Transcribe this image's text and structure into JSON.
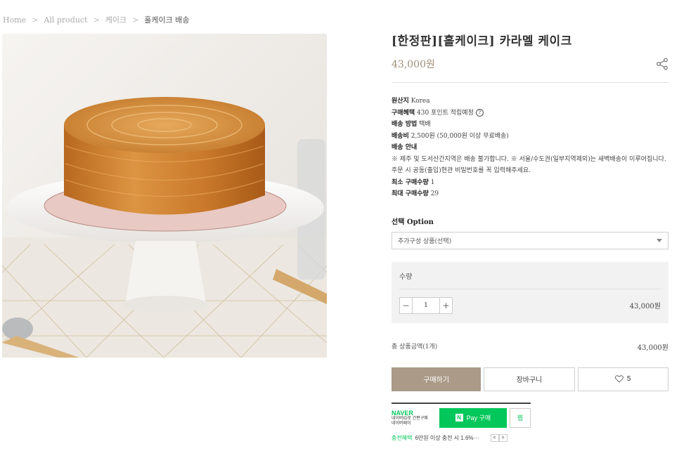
{
  "breadcrumb": {
    "items": [
      "Home",
      "All product",
      "케이크"
    ],
    "current": "홀케이크 배송",
    "separator": ">"
  },
  "product": {
    "title": "[한정판][홀케이크] 카라멜 케이크",
    "price": "43,000원",
    "share_icon": "share-icon"
  },
  "specs": {
    "origin_label": "원산지",
    "origin_value": "Korea",
    "benefit_label": "구매혜택",
    "benefit_value": "430 포인트 적립예정",
    "ship_method_label": "배송 방법",
    "ship_method_value": "택배",
    "ship_fee_label": "배송비",
    "ship_fee_value": "2,500원 (50,000원 이상 무료배송)",
    "ship_guide_label": "배송 안내",
    "ship_guide_text": "※ 제주 및 도서산간지역은 배송 불가합니다. ※ 서울/수도권(일부지역제외)는 새벽배송이 이루어집니다. 주문 시 공동(출입)현관 비밀번호를 꼭 입력해주세요.",
    "min_qty_label": "최소 구매수량",
    "min_qty_value": "1",
    "max_qty_label": "최대 구매수량",
    "max_qty_value": "29"
  },
  "option": {
    "label": "선택 Option",
    "selected": "추가구성 상품(선택)"
  },
  "quantity": {
    "label": "수량",
    "minus": "−",
    "value": "1",
    "plus": "+",
    "line_price": "43,000원"
  },
  "total": {
    "label": "총 상품금액(1개)",
    "price": "43,000원"
  },
  "actions": {
    "buy": "구매하기",
    "cart": "장바구니",
    "wish_count": "5"
  },
  "naver": {
    "logo": "NAVER",
    "sub1": "네이버ID로 간편구매",
    "sub2": "네이버페이",
    "pay_badge": "N",
    "pay_label": "Pay 구매",
    "zzim": "찜",
    "benefit_tag": "충전혜택",
    "benefit_text": "6만원 이상 충전 시 1.6%···",
    "prev": "<",
    "next": ">"
  },
  "colors": {
    "accent": "#aa9a87",
    "price": "#a08c76",
    "naver_green": "#03c75a"
  }
}
